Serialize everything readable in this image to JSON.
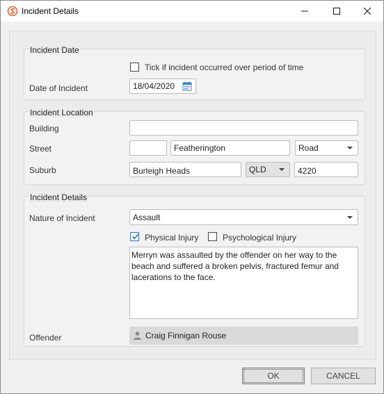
{
  "window": {
    "title": "Incident Details",
    "icons": {
      "app": "sync-logo-icon",
      "minimize": "minimize-icon",
      "maximize": "maximize-icon",
      "close": "close-icon"
    }
  },
  "incident_date": {
    "group_title": "Incident Date",
    "period_checkbox_label": "Tick if incident occurred over period of time",
    "period_checked": false,
    "date_label": "Date of Incident",
    "date_value": "18/04/2020"
  },
  "incident_location": {
    "group_title": "Incident Location",
    "building_label": "Building",
    "building_value": "",
    "street_label": "Street",
    "street_number_value": "",
    "street_name_value": "Featherington",
    "street_type_value": "Road",
    "suburb_label": "Suburb",
    "suburb_value": "Burleigh Heads",
    "state_value": "QLD",
    "postcode_value": "4220"
  },
  "incident_details": {
    "group_title": "Incident Details",
    "nature_label": "Nature of Incident",
    "nature_value": "Assault",
    "physical_injury_label": "Physical Injury",
    "physical_injury_checked": true,
    "psychological_injury_label": "Psychological Injury",
    "psychological_injury_checked": false,
    "description": "Merryn was assaulted by the offender on her way to the beach and suffered a broken pelvis, fractured femur and lacerations to the face.",
    "offender_label": "Offender",
    "offender_value": "Craig Finnigan Rouse"
  },
  "buttons": {
    "ok_label": "OK",
    "cancel_label": "CANCEL"
  },
  "colors": {
    "accent": "#2b73c8",
    "logo": "#e8622a"
  }
}
